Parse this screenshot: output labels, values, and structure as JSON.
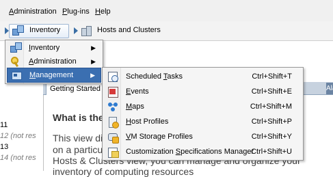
{
  "menubar": {
    "items": [
      {
        "label_pre": "",
        "label_u": "A",
        "label_post": "dministration"
      },
      {
        "label_pre": "",
        "label_u": "P",
        "label_post": "lug-ins"
      },
      {
        "label_pre": "",
        "label_u": "H",
        "label_post": "elp"
      }
    ]
  },
  "breadcrumb": {
    "inventory_label": "Inventory",
    "hosts_clusters_label": "Hosts and Clusters",
    "inventory_icon": "inventory-icon",
    "hosts_icon": "hosts-clusters-icon"
  },
  "inventory_menu": {
    "items": [
      {
        "label_pre": "",
        "label_u": "I",
        "label_post": "nventory",
        "icon": "inventory-icon",
        "has_submenu": true
      },
      {
        "label_pre": "",
        "label_u": "A",
        "label_post": "dministration",
        "icon": "key-icon",
        "has_submenu": true
      },
      {
        "label_pre": "",
        "label_u": "M",
        "label_post": "anagement",
        "icon": "management-icon",
        "has_submenu": true,
        "active": true
      }
    ],
    "arrow": "▶"
  },
  "management_submenu": {
    "items": [
      {
        "label_pre": "Scheduled ",
        "label_u": "T",
        "label_post": "asks",
        "shortcut": "Ctrl+Shift+T",
        "icon": "scheduled-tasks-icon"
      },
      {
        "label_pre": "",
        "label_u": "E",
        "label_post": "vents",
        "shortcut": "Ctrl+Shift+E",
        "icon": "events-icon"
      },
      {
        "label_pre": "",
        "label_u": "M",
        "label_post": "aps",
        "shortcut": "Ctrl+Shift+M",
        "icon": "maps-icon"
      },
      {
        "label_pre": "",
        "label_u": "H",
        "label_post": "ost Profiles",
        "shortcut": "Ctrl+Shift+P",
        "icon": "host-profiles-icon"
      },
      {
        "label_pre": "",
        "label_u": "V",
        "label_post": "M Storage Profiles",
        "shortcut": "Ctrl+Shift+Y",
        "icon": "vm-storage-profiles-icon"
      },
      {
        "label_pre": "Customization ",
        "label_u": "S",
        "label_post": "pecifications Manager",
        "shortcut": "Ctrl+Shift+U",
        "icon": "customization-specs-icon"
      }
    ]
  },
  "content": {
    "tab_getting_started": "Getting Started",
    "tab_partial": "Ala",
    "heading": "What is the",
    "lines": [
      "This view di",
      "on a particu",
      "Hosts & Clusters view, you can manage and organize your",
      "inventory of computing resources"
    ]
  },
  "left_list": [
    {
      "text": "11",
      "muted": false
    },
    {
      "text": "12 (not res",
      "muted": true
    },
    {
      "text": "13",
      "muted": false
    },
    {
      "text": "14 (not res",
      "muted": true
    }
  ]
}
